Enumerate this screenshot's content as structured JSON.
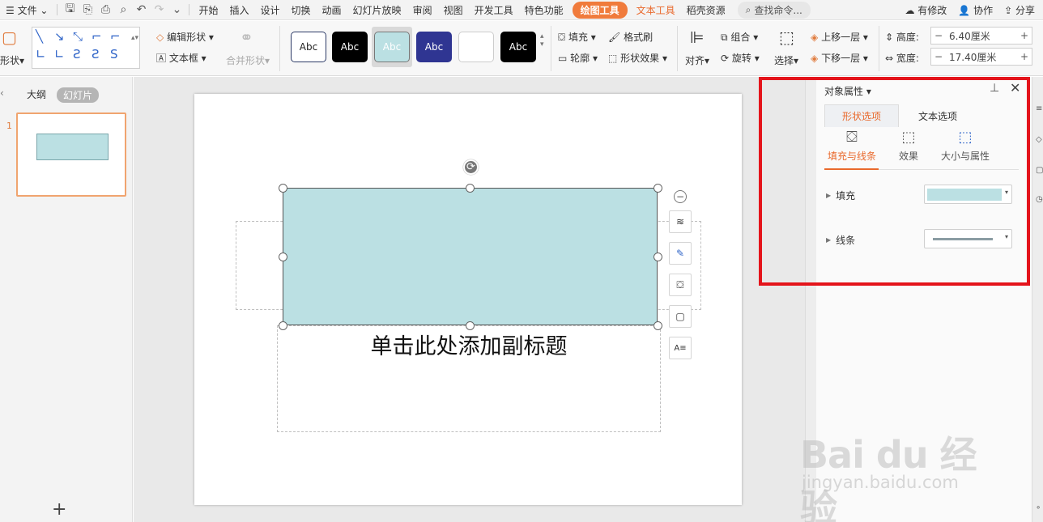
{
  "menubar": {
    "file": "文件",
    "tabs": [
      "开始",
      "插入",
      "设计",
      "切换",
      "动画",
      "幻灯片放映",
      "审阅",
      "视图",
      "开发工具",
      "特色功能"
    ],
    "active_tab": "绘图工具",
    "text_tool_tab": "文本工具",
    "resource_tab": "稻壳资源",
    "search_placeholder": "查找命令...",
    "right": {
      "modified": "有修改",
      "collab": "协作",
      "share": "分享"
    }
  },
  "ribbon": {
    "shape_label": "形状",
    "edit_shape": "编辑形状",
    "textbox": "文本框",
    "merge_shape": "合并形状",
    "style_samples": [
      "Abc",
      "Abc",
      "Abc",
      "Abc",
      "",
      "Abc"
    ],
    "fill": "填充",
    "format_painter": "格式刷",
    "outline": "轮廓",
    "shape_effect": "形状效果",
    "align": "对齐",
    "group": "组合",
    "rotate": "旋转",
    "select": "选择",
    "bring_forward": "上移一层",
    "send_backward": "下移一层",
    "height_label": "高度:",
    "height_value": "6.40厘米",
    "width_label": "宽度:",
    "width_value": "17.40厘米"
  },
  "left_panel": {
    "tab_outline": "大纲",
    "tab_slides": "幻灯片",
    "slide_number": "1"
  },
  "slide": {
    "subtitle_placeholder": "单击此处添加副标题"
  },
  "properties": {
    "title": "对象属性",
    "tab_shape": "形状选项",
    "tab_text": "文本选项",
    "subtab_fill_line": "填充与线条",
    "subtab_effect": "效果",
    "subtab_size": "大小与属性",
    "fill_label": "填充",
    "line_label": "线条",
    "fill_color": "#bbe0e3",
    "line_color": "#8a9ca3"
  },
  "watermark": {
    "main": "Bai du 经验",
    "sub": "jingyan.baidu.com"
  },
  "colors": {
    "accent": "#f07b3c",
    "highlight_box": "#e4141b",
    "shape_fill": "#bbe0e3"
  }
}
